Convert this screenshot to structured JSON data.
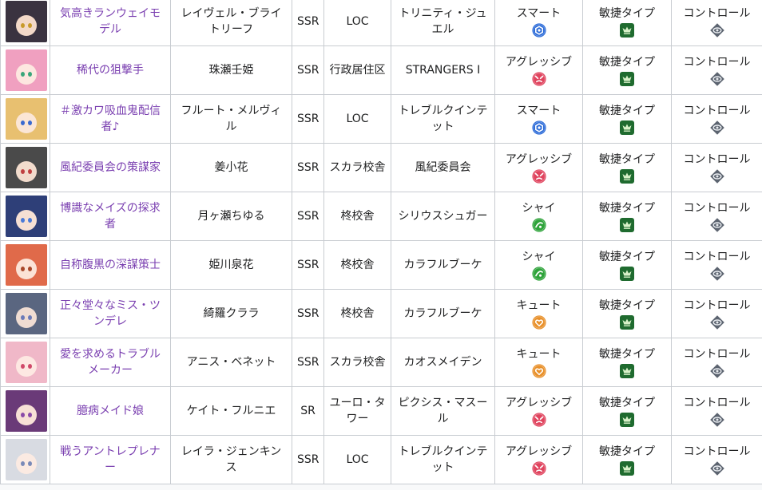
{
  "colors": {
    "link": "#7a3fb0",
    "border": "#c8ccd1",
    "smart": "#2a6ad8",
    "aggressive": "#e0445e",
    "shy": "#2ea33a",
    "cute": "#e8902a",
    "agile": "#1f6b2f",
    "control": "#5c6470"
  },
  "rows": [
    {
      "title": "気高きランウェイモデル",
      "name": "レイヴェル・ブライトリーフ",
      "rarity": "SSR",
      "location": "LOC",
      "unit": "トリニティ・ジュエル",
      "attribute": "スマート",
      "attr_icon": "smart-attribute-icon",
      "type": "敏捷タイプ",
      "role": "コントロール",
      "avatar": {
        "hair": "#3a3340",
        "face": "#f3d9c8",
        "eye": "#c89a2a"
      }
    },
    {
      "title": "稀代の狙撃手",
      "name": "珠瀬壬姫",
      "rarity": "SSR",
      "location": "行政居住区",
      "unit": "STRANGERS Ⅰ",
      "attribute": "アグレッシブ",
      "attr_icon": "aggressive-attribute-icon",
      "type": "敏捷タイプ",
      "role": "コントロール",
      "avatar": {
        "hair": "#f0a0c0",
        "face": "#fde7e0",
        "eye": "#3aa67a"
      }
    },
    {
      "title": "＃激カワ吸血鬼配信者♪",
      "name": "フルート・メルヴィル",
      "rarity": "SSR",
      "location": "LOC",
      "unit": "トレブルクインテット",
      "attribute": "スマート",
      "attr_icon": "smart-attribute-icon",
      "type": "敏捷タイプ",
      "role": "コントロール",
      "avatar": {
        "hair": "#e8c070",
        "face": "#fbe6d6",
        "eye": "#3a6ad0"
      }
    },
    {
      "title": "風紀委員会の策謀家",
      "name": "姜小花",
      "rarity": "SSR",
      "location": "スカラ校舎",
      "unit": "風紀委員会",
      "attribute": "アグレッシブ",
      "attr_icon": "aggressive-attribute-icon",
      "type": "敏捷タイプ",
      "role": "コントロール",
      "avatar": {
        "hair": "#4a4a4a",
        "face": "#f2dccd",
        "eye": "#c04040"
      }
    },
    {
      "title": "博識なメイズの探求者",
      "name": "月ヶ瀬ちゆる",
      "rarity": "SSR",
      "location": "柊校舎",
      "unit": "シリウスシュガー",
      "attribute": "シャイ",
      "attr_icon": "shy-attribute-icon",
      "type": "敏捷タイプ",
      "role": "コントロール",
      "avatar": {
        "hair": "#2e3f78",
        "face": "#f6e0d4",
        "eye": "#4a7ad8"
      }
    },
    {
      "title": "自称腹黒の深謀策士",
      "name": "姫川泉花",
      "rarity": "SSR",
      "location": "柊校舎",
      "unit": "カラフルブーケ",
      "attribute": "シャイ",
      "attr_icon": "shy-attribute-icon",
      "type": "敏捷タイプ",
      "role": "コントロール",
      "avatar": {
        "hair": "#e06a4a",
        "face": "#fbe3d6",
        "eye": "#a8482a"
      }
    },
    {
      "title": "正々堂々なミス・ツンデレ",
      "name": "綺羅クララ",
      "rarity": "SSR",
      "location": "柊校舎",
      "unit": "カラフルブーケ",
      "attribute": "キュート",
      "attr_icon": "cute-attribute-icon",
      "type": "敏捷タイプ",
      "role": "コントロール",
      "avatar": {
        "hair": "#5a6680",
        "face": "#efdcd2",
        "eye": "#6a7ab8"
      }
    },
    {
      "title": "愛を求めるトラブルメーカー",
      "name": "アニス・ベネット",
      "rarity": "SSR",
      "location": "スカラ校舎",
      "unit": "カオスメイデン",
      "attribute": "キュート",
      "attr_icon": "cute-attribute-icon",
      "type": "敏捷タイプ",
      "role": "コントロール",
      "avatar": {
        "hair": "#f0b8c8",
        "face": "#fde8e2",
        "eye": "#d04a6a"
      }
    },
    {
      "title": "臆病メイド娘",
      "name": "ケイト・フルニエ",
      "rarity": "SR",
      "location": "ユーロ・タワー",
      "unit": "ピクシス・マスール",
      "attribute": "アグレッシブ",
      "attr_icon": "aggressive-attribute-icon",
      "type": "敏捷タイプ",
      "role": "コントロール",
      "avatar": {
        "hair": "#6a3a78",
        "face": "#f7e0d6",
        "eye": "#8a4aa8"
      }
    },
    {
      "title": "戦うアントレプレナー",
      "name": "レイラ・ジェンキンス",
      "rarity": "SSR",
      "location": "LOC",
      "unit": "トレブルクインテット",
      "attribute": "アグレッシブ",
      "attr_icon": "aggressive-attribute-icon",
      "type": "敏捷タイプ",
      "role": "コントロール",
      "avatar": {
        "hair": "#d8dbe2",
        "face": "#fbeae2",
        "eye": "#7a8ab8"
      }
    }
  ]
}
